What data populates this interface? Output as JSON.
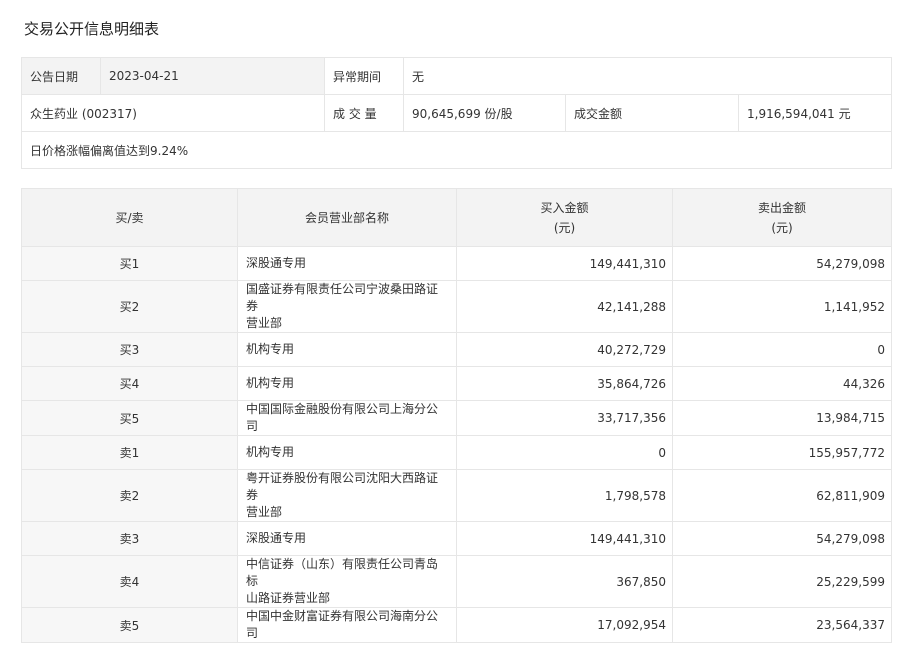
{
  "page": {
    "title": "交易公开信息明细表"
  },
  "info": {
    "announce_date_label": "公告日期",
    "announce_date": "2023-04-21",
    "abnormal_period_label": "异常期间",
    "abnormal_period": "无",
    "stock_name": "众生药业 (002317)",
    "volume_label": "成 交 量",
    "volume": "90,645,699 份/股",
    "turnover_label": "成交金额",
    "turnover": "1,916,594,041 元",
    "reason": "日价格涨幅偏离值达到9.24%"
  },
  "columns": {
    "side": "买/卖",
    "broker": "会员营业部名称",
    "buy_amount": "买入金额",
    "buy_unit": "(元)",
    "sell_amount": "卖出金额",
    "sell_unit": "(元)"
  },
  "rows": [
    {
      "side": "买1",
      "broker_l1": "深股通专用",
      "broker_l2": "",
      "buy": "149,441,310",
      "sell": "54,279,098"
    },
    {
      "side": "买2",
      "broker_l1": "国盛证券有限责任公司宁波桑田路证券",
      "broker_l2": "营业部",
      "buy": "42,141,288",
      "sell": "1,141,952"
    },
    {
      "side": "买3",
      "broker_l1": "机构专用",
      "broker_l2": "",
      "buy": "40,272,729",
      "sell": "0"
    },
    {
      "side": "买4",
      "broker_l1": "机构专用",
      "broker_l2": "",
      "buy": "35,864,726",
      "sell": "44,326"
    },
    {
      "side": "买5",
      "broker_l1": "中国国际金融股份有限公司上海分公司",
      "broker_l2": "",
      "buy": "33,717,356",
      "sell": "13,984,715"
    },
    {
      "side": "卖1",
      "broker_l1": "机构专用",
      "broker_l2": "",
      "buy": "0",
      "sell": "155,957,772"
    },
    {
      "side": "卖2",
      "broker_l1": "粤开证券股份有限公司沈阳大西路证券",
      "broker_l2": "营业部",
      "buy": "1,798,578",
      "sell": "62,811,909"
    },
    {
      "side": "卖3",
      "broker_l1": "深股通专用",
      "broker_l2": "",
      "buy": "149,441,310",
      "sell": "54,279,098"
    },
    {
      "side": "卖4",
      "broker_l1": "中信证券（山东）有限责任公司青岛标",
      "broker_l2": "山路证券营业部",
      "buy": "367,850",
      "sell": "25,229,599"
    },
    {
      "side": "卖5",
      "broker_l1": "中国中金财富证券有限公司海南分公司",
      "broker_l2": "",
      "buy": "17,092,954",
      "sell": "23,564,337"
    }
  ]
}
